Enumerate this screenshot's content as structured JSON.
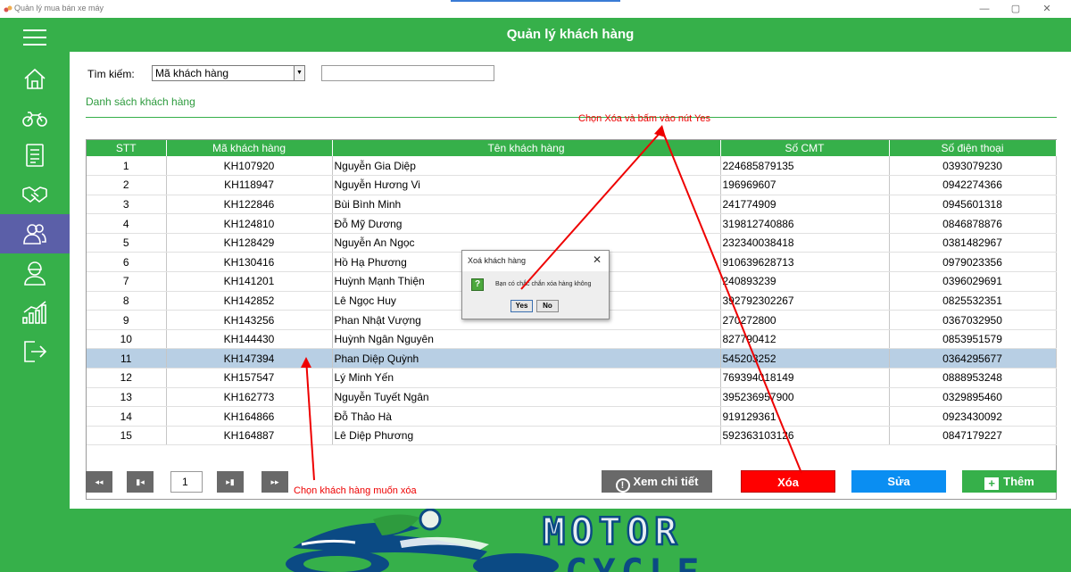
{
  "window": {
    "title": "Quản lý mua bán xe máy",
    "minimize_glyph": "—",
    "maximize_glyph": "▢",
    "close_glyph": "✕"
  },
  "header": {
    "title": "Quản lý khách hàng"
  },
  "sidebar": {
    "items": [
      {
        "icon": "hamburger-menu-icon"
      },
      {
        "icon": "home-icon"
      },
      {
        "icon": "motorbike-icon"
      },
      {
        "icon": "invoice-icon"
      },
      {
        "icon": "handshake-icon"
      },
      {
        "icon": "customers-icon",
        "active": true
      },
      {
        "icon": "employee-icon"
      },
      {
        "icon": "statistics-chart-icon"
      },
      {
        "icon": "logout-icon"
      }
    ]
  },
  "search": {
    "label": "Tìm kiếm:",
    "field_selected": "Mã khách hàng",
    "input_value": ""
  },
  "section": {
    "title": "Danh sách khách hàng"
  },
  "table": {
    "columns": [
      "STT",
      "Mã khách hàng",
      "Tên khách hàng",
      "Số CMT",
      "Số điện thoại"
    ],
    "rows": [
      [
        "1",
        "KH107920",
        "Nguyễn Gia Diệp",
        "224685879135",
        "0393079230"
      ],
      [
        "2",
        "KH118947",
        "Nguyễn Hương Vi",
        "196969607",
        "0942274366"
      ],
      [
        "3",
        "KH122846",
        "Bùi Bình Minh",
        "241774909",
        "0945601318"
      ],
      [
        "4",
        "KH124810",
        "Đỗ Mỹ Dương",
        "319812740886",
        "0846878876"
      ],
      [
        "5",
        "KH128429",
        "Nguyễn An Ngọc",
        "232340038418",
        "0381482967"
      ],
      [
        "6",
        "KH130416",
        "Hồ Hạ Phương",
        "910639628713",
        "0979023356"
      ],
      [
        "7",
        "KH141201",
        "Huỳnh Mạnh Thiện",
        "240893239",
        "0396029691"
      ],
      [
        "8",
        "KH142852",
        "Lê Ngọc Huy",
        "392792302267",
        "0825532351"
      ],
      [
        "9",
        "KH143256",
        "Phan Nhật Vượng",
        "270272800",
        "0367032950"
      ],
      [
        "10",
        "KH144430",
        "Huỳnh Ngân Nguyên",
        "827790412",
        "0853951579"
      ],
      [
        "11",
        "KH147394",
        "Phan Diệp Quỳnh",
        "545203252",
        "0364295677"
      ],
      [
        "12",
        "KH157547",
        "Lý Minh Yến",
        "769394018149",
        "0888953248"
      ],
      [
        "13",
        "KH162773",
        "Nguyễn Tuyết Ngân",
        "395236957900",
        "0329895460"
      ],
      [
        "14",
        "KH164866",
        "Đỗ Thảo Hà",
        "919129361",
        "0923430092"
      ],
      [
        "15",
        "KH164887",
        "Lê Diệp Phương",
        "592363103126",
        "0847179227"
      ]
    ],
    "selected_index": 10
  },
  "pagination": {
    "first": "◂◂",
    "prev": "▮◂",
    "page": "1",
    "next": "▸▮",
    "last": "▸▸"
  },
  "actions": {
    "detail": "Xem chi tiết",
    "detail_icon": "!",
    "delete": "Xóa",
    "edit": "Sửa",
    "add": "Thêm",
    "add_icon": "+"
  },
  "dialog": {
    "title": "Xoá khách hàng",
    "close": "✕",
    "icon": "?",
    "message": "Bạn có chắc chắn xóa hàng không",
    "yes": "Yes",
    "no": "No"
  },
  "annotations": {
    "top": "Chọn Xóa và bấm vào nút Yes",
    "bottom": "Chọn khách hàng muốn xóa"
  },
  "logo": {
    "line1": "MOTOR",
    "line2": "CYCLE"
  },
  "colors": {
    "brand_green": "#36b04a",
    "delete_red": "#ff0000",
    "edit_blue": "#0a8ef2",
    "selected_row": "#b8cfe4",
    "active_sidebar": "#5b5fa8",
    "annotation_red": "#e00000"
  }
}
